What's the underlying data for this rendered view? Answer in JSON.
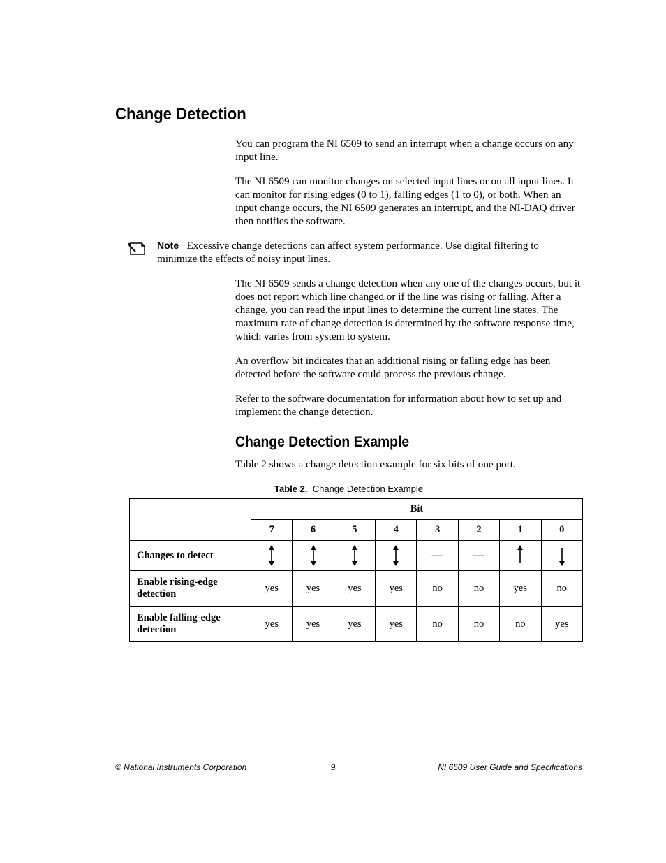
{
  "section_title": "Change Detection",
  "paragraphs": {
    "p1": "You can program the NI 6509 to send an interrupt when a change occurs on any input line.",
    "p2": "The NI 6509 can monitor changes on selected input lines or on all input lines. It can monitor for rising edges (0 to 1), falling edges (1 to 0), or both. When an input change occurs, the NI 6509 generates an interrupt, and the NI-DAQ driver then notifies the software.",
    "p3": "The NI 6509 sends a change detection when any one of the changes occurs, but it does not report which line changed or if the line was rising or falling. After a change, you can read the input lines to determine the current line states. The maximum rate of change detection is determined by the software response time, which varies from system to system.",
    "p4": "An overflow bit indicates that an additional rising or falling edge has been detected before the software could process the previous change.",
    "p5": "Refer to the software documentation for information about how to set up and implement the change detection."
  },
  "note": {
    "label": "Note",
    "text": "Excessive change detections can affect system performance. Use digital filtering to minimize the effects of noisy input lines."
  },
  "subsection_title": "Change Detection Example",
  "subsection_intro": "Table 2 shows a change detection example for six bits of one port.",
  "table": {
    "caption_label": "Table 2.",
    "caption_text": "Change Detection Example",
    "group_header": "Bit",
    "bit_headers": [
      "7",
      "6",
      "5",
      "4",
      "3",
      "2",
      "1",
      "0"
    ],
    "rows": [
      {
        "label": "Changes to detect",
        "cells": [
          "both",
          "both",
          "both",
          "both",
          "none",
          "none",
          "rising",
          "falling"
        ]
      },
      {
        "label": "Enable rising-edge detection",
        "cells": [
          "yes",
          "yes",
          "yes",
          "yes",
          "no",
          "no",
          "yes",
          "no"
        ]
      },
      {
        "label": "Enable falling-edge detection",
        "cells": [
          "yes",
          "yes",
          "yes",
          "yes",
          "no",
          "no",
          "no",
          "yes"
        ]
      }
    ]
  },
  "footer": {
    "left": "© National Instruments Corporation",
    "center": "9",
    "right": "NI 6509 User Guide and Specifications"
  }
}
